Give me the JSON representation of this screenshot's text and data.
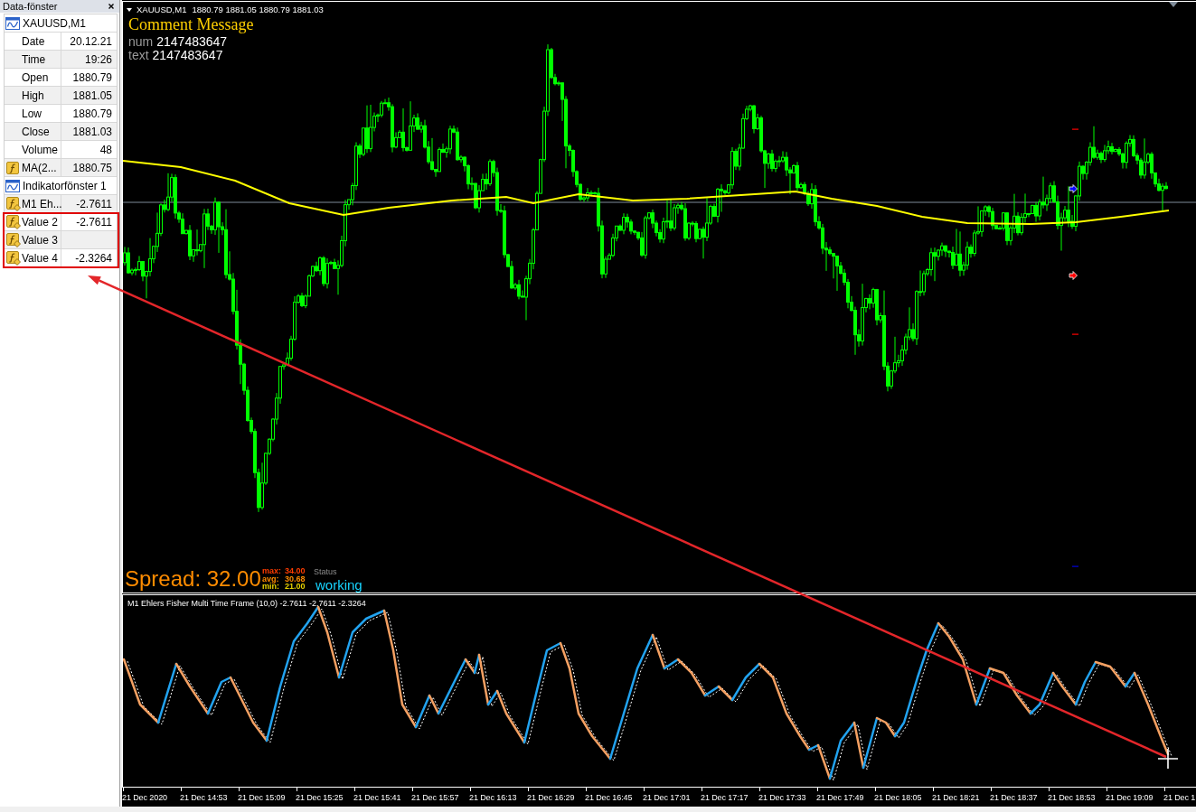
{
  "data_window": {
    "title": "Data-fönster",
    "rows": [
      {
        "kind": "header",
        "label": "XAUUSD,M1",
        "highlighted": false
      },
      {
        "kind": "field",
        "label": "Date",
        "value": "20.12.21",
        "highlighted": false
      },
      {
        "kind": "field",
        "label": "Time",
        "value": "19:26",
        "highlighted": false
      },
      {
        "kind": "field",
        "label": "Open",
        "value": "1880.79",
        "highlighted": false
      },
      {
        "kind": "field",
        "label": "High",
        "value": "1881.05",
        "highlighted": false
      },
      {
        "kind": "field",
        "label": "Low",
        "value": "1880.79",
        "highlighted": false
      },
      {
        "kind": "field",
        "label": "Close",
        "value": "1881.03",
        "highlighted": false
      },
      {
        "kind": "field",
        "label": "Volume",
        "value": "48",
        "highlighted": false
      },
      {
        "kind": "indicator",
        "label": "MA(2...",
        "value": "1880.75",
        "highlighted": false
      },
      {
        "kind": "header",
        "label": "Indikatorfönster 1",
        "highlighted": false
      },
      {
        "kind": "custom_indicator",
        "label": "M1 Eh...",
        "value": "-2.7611",
        "highlighted": false
      },
      {
        "kind": "custom_indicator",
        "label": "Value 2",
        "value": "-2.7611",
        "highlighted": true
      },
      {
        "kind": "custom_indicator",
        "label": "Value 3",
        "highlighted": true
      },
      {
        "kind": "custom_indicator",
        "label": "Value 4",
        "value": "-2.3264",
        "highlighted": true
      }
    ]
  },
  "chart": {
    "header": {
      "symbol": "XAUUSD,M1",
      "prices": "1880.79 1881.05 1880.79 1881.03"
    },
    "comment": {
      "title": "Comment Message",
      "lines": [
        {
          "label": "num",
          "value": "2147483647"
        },
        {
          "label": "text",
          "value": "2147483647"
        }
      ]
    },
    "spread": {
      "label": "Spread: 32.00",
      "stats": [
        {
          "label": "max:",
          "value": "34.00",
          "color": "#ff3c00"
        },
        {
          "label": "avg:",
          "value": "30.68",
          "color": "#ff8c00"
        },
        {
          "label": "min:",
          "value": "21.00",
          "color": "#e6d200"
        }
      ]
    },
    "status": {
      "label": "Status",
      "value": "working"
    }
  },
  "indicator_window": {
    "title": "M1 Ehlers Fisher Multi Time Frame (10,0) -2.7611 -2.7611 -2.3264"
  },
  "time_axis": {
    "labels": [
      "21 Dec 2020",
      "21 Dec 14:53",
      "21 Dec 15:09",
      "21 Dec 15:25",
      "21 Dec 15:41",
      "21 Dec 15:57",
      "21 Dec 16:13",
      "21 Dec 16:29",
      "21 Dec 16:45",
      "21 Dec 17:01",
      "21 Dec 17:17",
      "21 Dec 17:33",
      "21 Dec 17:49",
      "21 Dec 18:05",
      "21 Dec 18:21",
      "21 Dec 18:37",
      "21 Dec 18:53",
      "21 Dec 19:09",
      "21 Dec 1"
    ]
  }
}
